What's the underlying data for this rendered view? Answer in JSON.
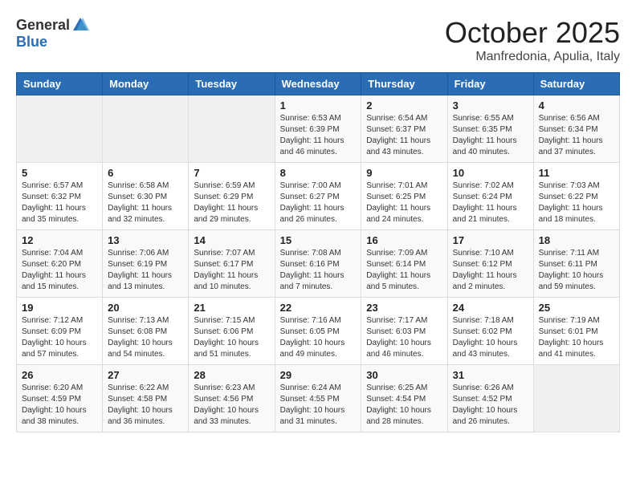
{
  "logo": {
    "general": "General",
    "blue": "Blue"
  },
  "title": "October 2025",
  "location": "Manfredonia, Apulia, Italy",
  "days_of_week": [
    "Sunday",
    "Monday",
    "Tuesday",
    "Wednesday",
    "Thursday",
    "Friday",
    "Saturday"
  ],
  "weeks": [
    [
      {
        "day": "",
        "info": ""
      },
      {
        "day": "",
        "info": ""
      },
      {
        "day": "",
        "info": ""
      },
      {
        "day": "1",
        "info": "Sunrise: 6:53 AM\nSunset: 6:39 PM\nDaylight: 11 hours\nand 46 minutes."
      },
      {
        "day": "2",
        "info": "Sunrise: 6:54 AM\nSunset: 6:37 PM\nDaylight: 11 hours\nand 43 minutes."
      },
      {
        "day": "3",
        "info": "Sunrise: 6:55 AM\nSunset: 6:35 PM\nDaylight: 11 hours\nand 40 minutes."
      },
      {
        "day": "4",
        "info": "Sunrise: 6:56 AM\nSunset: 6:34 PM\nDaylight: 11 hours\nand 37 minutes."
      }
    ],
    [
      {
        "day": "5",
        "info": "Sunrise: 6:57 AM\nSunset: 6:32 PM\nDaylight: 11 hours\nand 35 minutes."
      },
      {
        "day": "6",
        "info": "Sunrise: 6:58 AM\nSunset: 6:30 PM\nDaylight: 11 hours\nand 32 minutes."
      },
      {
        "day": "7",
        "info": "Sunrise: 6:59 AM\nSunset: 6:29 PM\nDaylight: 11 hours\nand 29 minutes."
      },
      {
        "day": "8",
        "info": "Sunrise: 7:00 AM\nSunset: 6:27 PM\nDaylight: 11 hours\nand 26 minutes."
      },
      {
        "day": "9",
        "info": "Sunrise: 7:01 AM\nSunset: 6:25 PM\nDaylight: 11 hours\nand 24 minutes."
      },
      {
        "day": "10",
        "info": "Sunrise: 7:02 AM\nSunset: 6:24 PM\nDaylight: 11 hours\nand 21 minutes."
      },
      {
        "day": "11",
        "info": "Sunrise: 7:03 AM\nSunset: 6:22 PM\nDaylight: 11 hours\nand 18 minutes."
      }
    ],
    [
      {
        "day": "12",
        "info": "Sunrise: 7:04 AM\nSunset: 6:20 PM\nDaylight: 11 hours\nand 15 minutes."
      },
      {
        "day": "13",
        "info": "Sunrise: 7:06 AM\nSunset: 6:19 PM\nDaylight: 11 hours\nand 13 minutes."
      },
      {
        "day": "14",
        "info": "Sunrise: 7:07 AM\nSunset: 6:17 PM\nDaylight: 11 hours\nand 10 minutes."
      },
      {
        "day": "15",
        "info": "Sunrise: 7:08 AM\nSunset: 6:16 PM\nDaylight: 11 hours\nand 7 minutes."
      },
      {
        "day": "16",
        "info": "Sunrise: 7:09 AM\nSunset: 6:14 PM\nDaylight: 11 hours\nand 5 minutes."
      },
      {
        "day": "17",
        "info": "Sunrise: 7:10 AM\nSunset: 6:12 PM\nDaylight: 11 hours\nand 2 minutes."
      },
      {
        "day": "18",
        "info": "Sunrise: 7:11 AM\nSunset: 6:11 PM\nDaylight: 10 hours\nand 59 minutes."
      }
    ],
    [
      {
        "day": "19",
        "info": "Sunrise: 7:12 AM\nSunset: 6:09 PM\nDaylight: 10 hours\nand 57 minutes."
      },
      {
        "day": "20",
        "info": "Sunrise: 7:13 AM\nSunset: 6:08 PM\nDaylight: 10 hours\nand 54 minutes."
      },
      {
        "day": "21",
        "info": "Sunrise: 7:15 AM\nSunset: 6:06 PM\nDaylight: 10 hours\nand 51 minutes."
      },
      {
        "day": "22",
        "info": "Sunrise: 7:16 AM\nSunset: 6:05 PM\nDaylight: 10 hours\nand 49 minutes."
      },
      {
        "day": "23",
        "info": "Sunrise: 7:17 AM\nSunset: 6:03 PM\nDaylight: 10 hours\nand 46 minutes."
      },
      {
        "day": "24",
        "info": "Sunrise: 7:18 AM\nSunset: 6:02 PM\nDaylight: 10 hours\nand 43 minutes."
      },
      {
        "day": "25",
        "info": "Sunrise: 7:19 AM\nSunset: 6:01 PM\nDaylight: 10 hours\nand 41 minutes."
      }
    ],
    [
      {
        "day": "26",
        "info": "Sunrise: 6:20 AM\nSunset: 4:59 PM\nDaylight: 10 hours\nand 38 minutes."
      },
      {
        "day": "27",
        "info": "Sunrise: 6:22 AM\nSunset: 4:58 PM\nDaylight: 10 hours\nand 36 minutes."
      },
      {
        "day": "28",
        "info": "Sunrise: 6:23 AM\nSunset: 4:56 PM\nDaylight: 10 hours\nand 33 minutes."
      },
      {
        "day": "29",
        "info": "Sunrise: 6:24 AM\nSunset: 4:55 PM\nDaylight: 10 hours\nand 31 minutes."
      },
      {
        "day": "30",
        "info": "Sunrise: 6:25 AM\nSunset: 4:54 PM\nDaylight: 10 hours\nand 28 minutes."
      },
      {
        "day": "31",
        "info": "Sunrise: 6:26 AM\nSunset: 4:52 PM\nDaylight: 10 hours\nand 26 minutes."
      },
      {
        "day": "",
        "info": ""
      }
    ]
  ]
}
